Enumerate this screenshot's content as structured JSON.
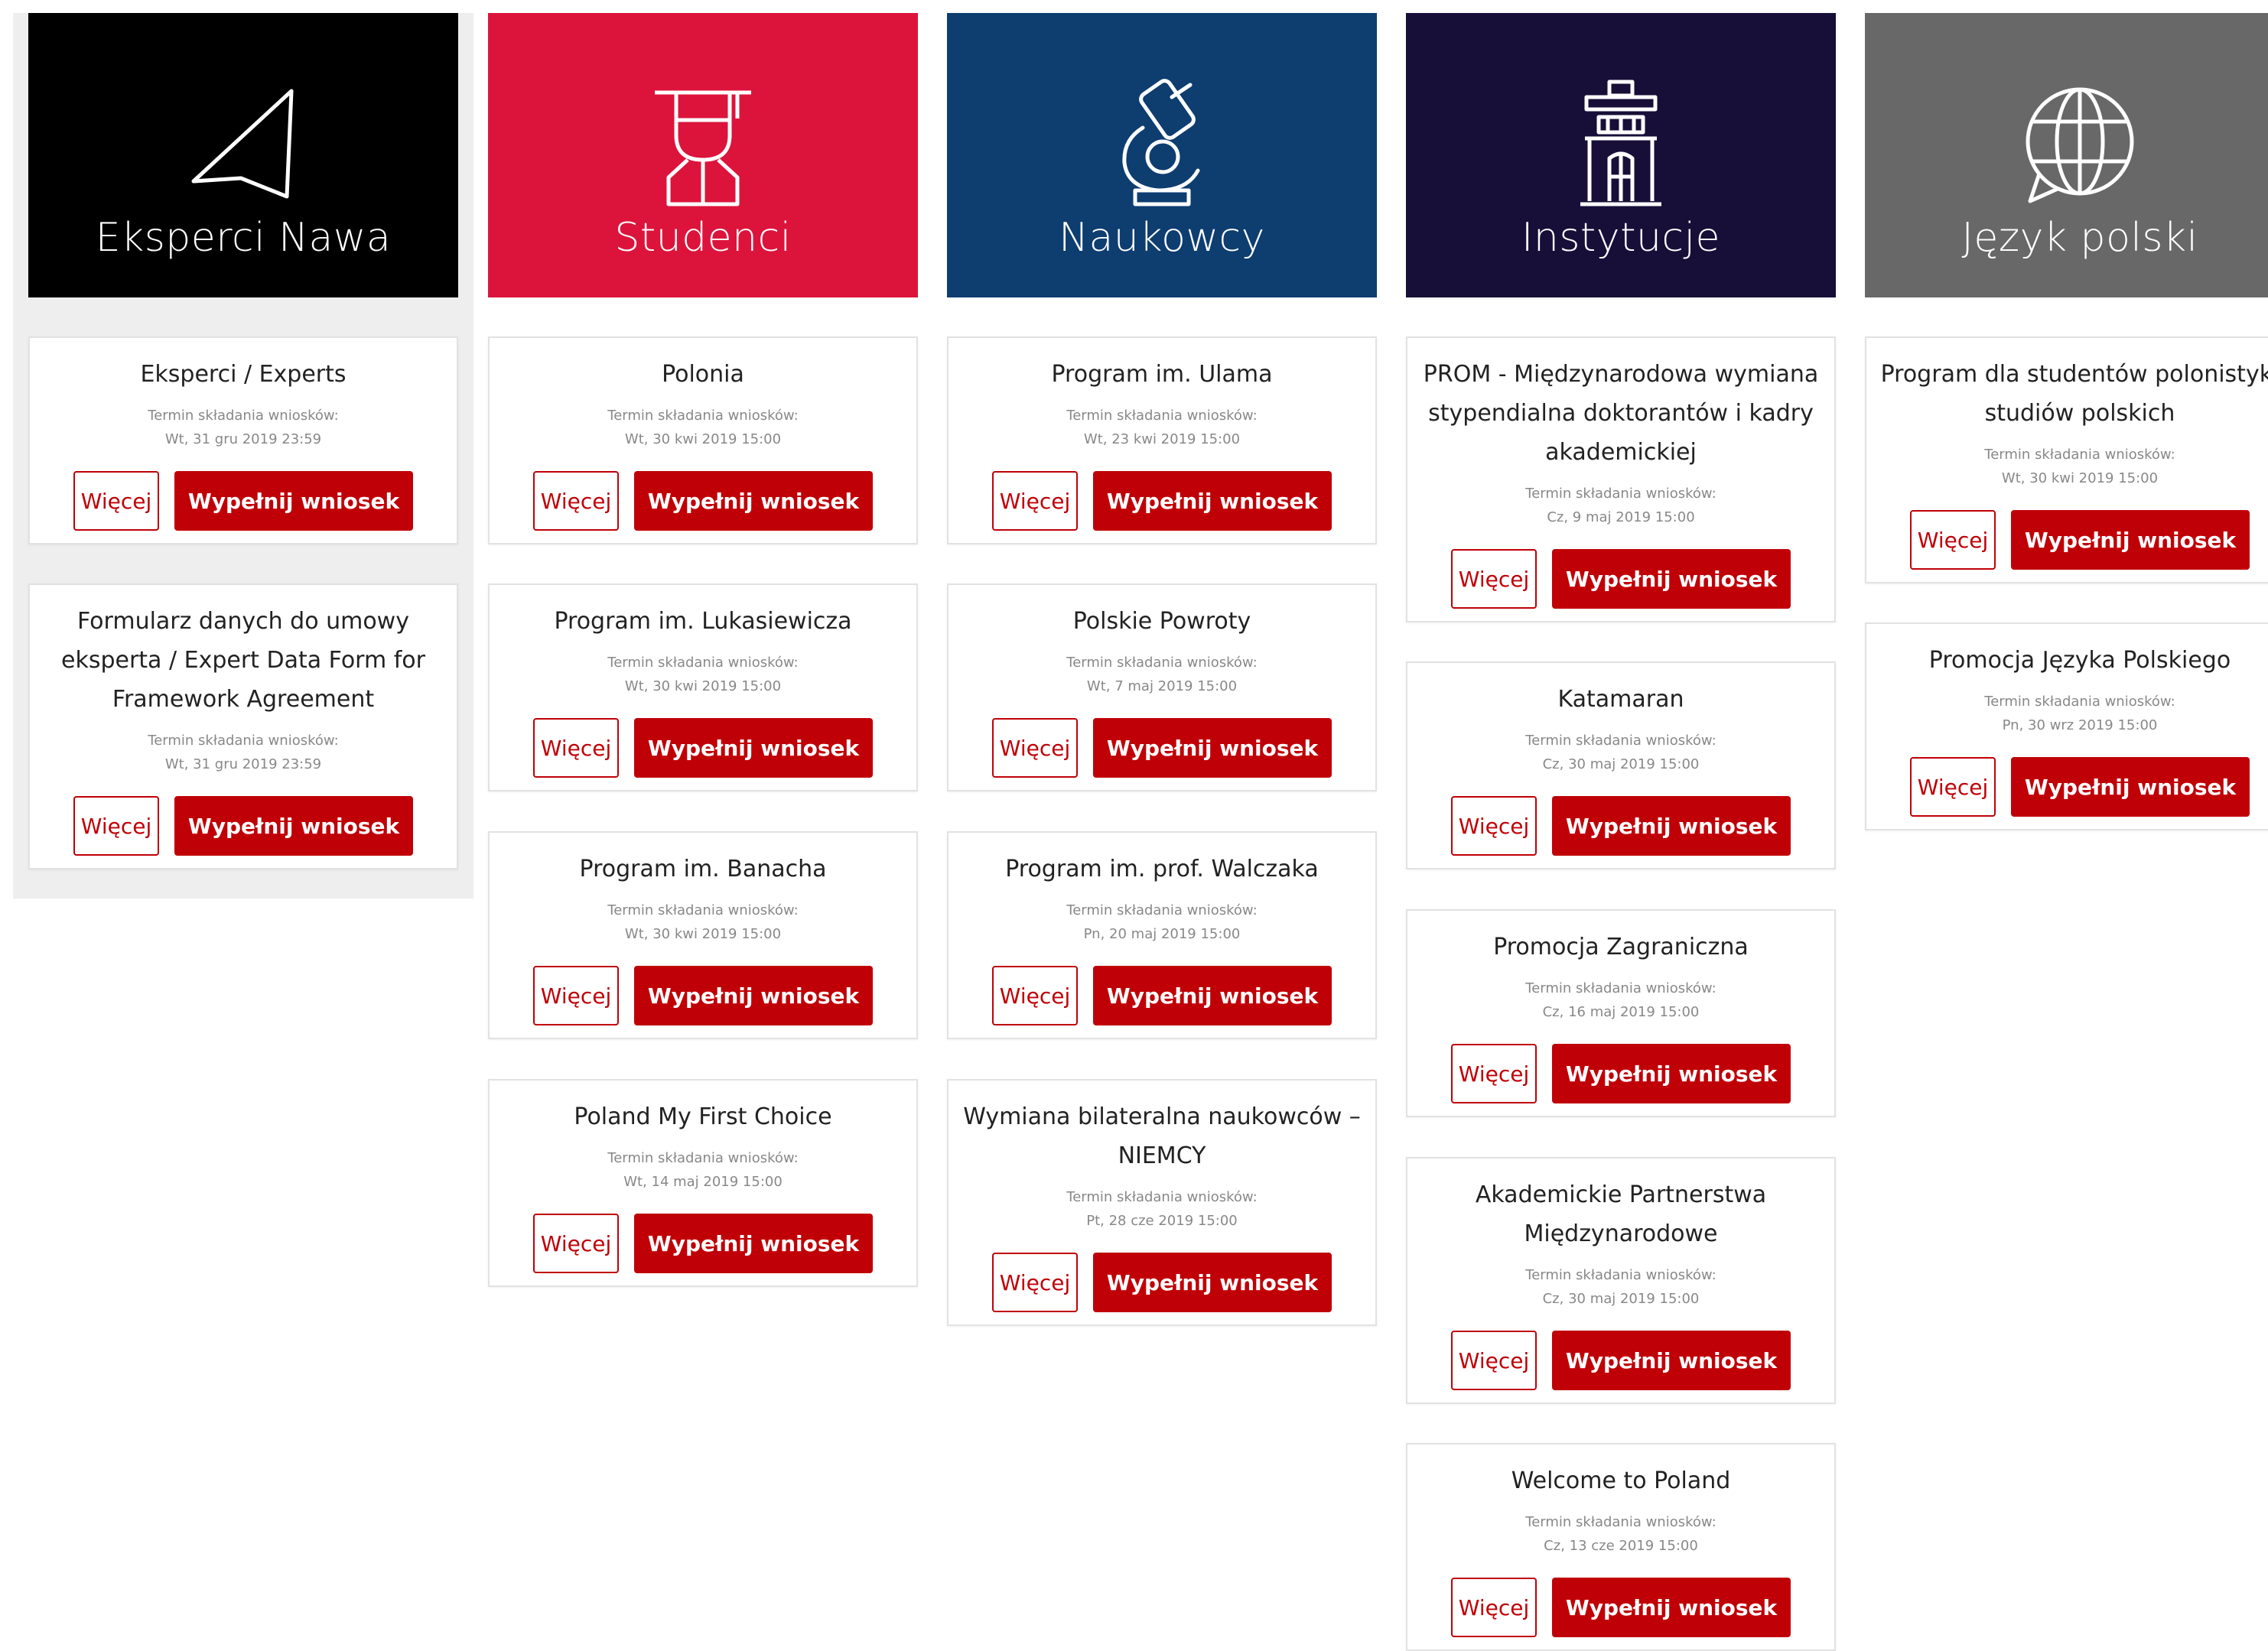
{
  "colors": {
    "eksperci": "#000000",
    "studenci": "#dc143c",
    "naukowcy": "#0e3d70",
    "instytucje": "#170f38",
    "jezyk": "#686868",
    "accent": "#c00007"
  },
  "columns": [
    {
      "title": "Eksperci Nawa",
      "icon": "send-arrow-icon",
      "cards": [
        {
          "title": "Eksperci / Experts",
          "label": "Termin składania wniosków:",
          "date": "Wt, 31 gru 2019 23:59",
          "more": "Więcej",
          "fill": "Wypełnij wniosek"
        },
        {
          "title": "Formularz danych do umowy eksperta / Expert Data Form for Framework Agreement",
          "label": "Termin składania wniosków:",
          "date": "Wt, 31 gru 2019 23:59",
          "more": "Więcej",
          "fill": "Wypełnij wniosek"
        }
      ]
    },
    {
      "title": "Studenci",
      "icon": "graduate-icon",
      "cards": [
        {
          "title": "Polonia",
          "label": "Termin składania wniosków:",
          "date": "Wt, 30 kwi 2019 15:00",
          "more": "Więcej",
          "fill": "Wypełnij wniosek"
        },
        {
          "title": "Program im. Lukasiewicza",
          "label": "Termin składania wniosków:",
          "date": "Wt, 30 kwi 2019 15:00",
          "more": "Więcej",
          "fill": "Wypełnij wniosek"
        },
        {
          "title": "Program im. Banacha",
          "label": "Termin składania wniosków:",
          "date": "Wt, 30 kwi 2019 15:00",
          "more": "Więcej",
          "fill": "Wypełnij wniosek"
        },
        {
          "title": "Poland My First Choice",
          "label": "Termin składania wniosków:",
          "date": "Wt, 14 maj 2019 15:00",
          "more": "Więcej",
          "fill": "Wypełnij wniosek"
        }
      ]
    },
    {
      "title": "Naukowcy",
      "icon": "microscope-icon",
      "cards": [
        {
          "title": "Program im. Ulama",
          "label": "Termin składania wniosków:",
          "date": "Wt, 23 kwi 2019 15:00",
          "more": "Więcej",
          "fill": "Wypełnij wniosek"
        },
        {
          "title": "Polskie Powroty",
          "label": "Termin składania wniosków:",
          "date": "Wt, 7 maj 2019 15:00",
          "more": "Więcej",
          "fill": "Wypełnij wniosek"
        },
        {
          "title": "Program im. prof. Walczaka",
          "label": "Termin składania wniosków:",
          "date": "Pn, 20 maj 2019 15:00",
          "more": "Więcej",
          "fill": "Wypełnij wniosek"
        },
        {
          "title": "Wymiana bilateralna naukowców – NIEMCY",
          "label": "Termin składania wniosków:",
          "date": "Pt, 28 cze 2019 15:00",
          "more": "Więcej",
          "fill": "Wypełnij wniosek"
        }
      ]
    },
    {
      "title": "Instytucje",
      "icon": "institution-building-icon",
      "cards": [
        {
          "title": "PROM - Międzynarodowa wymiana stypendialna doktorantów i kadry akademickiej",
          "label": "Termin składania wniosków:",
          "date": "Cz, 9 maj 2019 15:00",
          "more": "Więcej",
          "fill": "Wypełnij wniosek"
        },
        {
          "title": "Katamaran",
          "label": "Termin składania wniosków:",
          "date": "Cz, 30 maj 2019 15:00",
          "more": "Więcej",
          "fill": "Wypełnij wniosek"
        },
        {
          "title": "Promocja Zagraniczna",
          "label": "Termin składania wniosków:",
          "date": "Cz, 16 maj 2019 15:00",
          "more": "Więcej",
          "fill": "Wypełnij wniosek"
        },
        {
          "title": "Akademickie Partnerstwa Międzynarodowe",
          "label": "Termin składania wniosków:",
          "date": "Cz, 30 maj 2019 15:00",
          "more": "Więcej",
          "fill": "Wypełnij wniosek"
        },
        {
          "title": "Welcome to Poland",
          "label": "Termin składania wniosków:",
          "date": "Cz, 13 cze 2019 15:00",
          "more": "Więcej",
          "fill": "Wypełnij wniosek"
        }
      ]
    },
    {
      "title": "Język polski",
      "icon": "globe-chat-icon",
      "cards": [
        {
          "title": "Program dla studentów polonistyki studiów polskich",
          "label": "Termin składania wniosków:",
          "date": "Wt, 30 kwi 2019 15:00",
          "more": "Więcej",
          "fill": "Wypełnij wniosek"
        },
        {
          "title": "Promocja Języka Polskiego",
          "label": "Termin składania wniosków:",
          "date": "Pn, 30 wrz 2019 15:00",
          "more": "Więcej",
          "fill": "Wypełnij wniosek"
        }
      ]
    }
  ]
}
